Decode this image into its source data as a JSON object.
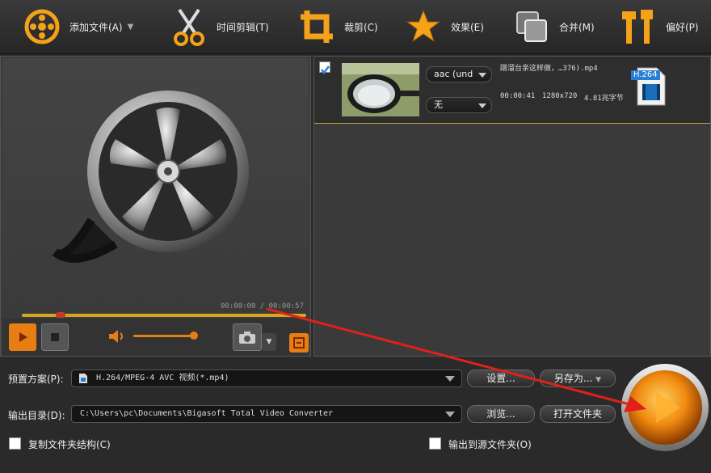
{
  "toolbar": {
    "items": [
      {
        "label": "添加文件(A)",
        "icon": "film-reel-icon",
        "has_dropdown": true
      },
      {
        "label": "时间剪辑(T)",
        "icon": "scissors-icon"
      },
      {
        "label": "裁剪(C)",
        "icon": "crop-icon"
      },
      {
        "label": "效果(E)",
        "icon": "star-icon"
      },
      {
        "label": "合并(M)",
        "icon": "merge-icon"
      },
      {
        "label": "偏好(P)",
        "icon": "tools-icon"
      }
    ]
  },
  "player": {
    "time_current": "00:00:00",
    "time_separator": "/",
    "time_total": "00:00:57"
  },
  "file": {
    "checked": true,
    "audio_track": "aac (und",
    "subtitle": "无",
    "name": "蹭溜台亲这样做，…376).mp4",
    "duration": "00:00:41",
    "resolution": "1280x720",
    "size": "4.81兆字节",
    "codec_badge": "H.264"
  },
  "bottom": {
    "preset_label": "预置方案(P):",
    "preset_value": "H.264/MPEG-4 AVC 视频(*.mp4)",
    "settings_button": "设置...",
    "save_as_button": "另存为...",
    "output_label": "输出目录(D):",
    "output_value": "C:\\Users\\pc\\Documents\\Bigasoft Total Video Converter",
    "browse_button": "浏览...",
    "open_folder_button": "打开文件夹",
    "copy_structure_label": "复制文件夹结构(C)",
    "output_to_source_label": "输出到源文件夹(O)"
  },
  "colors": {
    "accent_orange": "#e87d13",
    "seek_yellow": "#d4a520",
    "annotation_red": "#e0201a"
  }
}
